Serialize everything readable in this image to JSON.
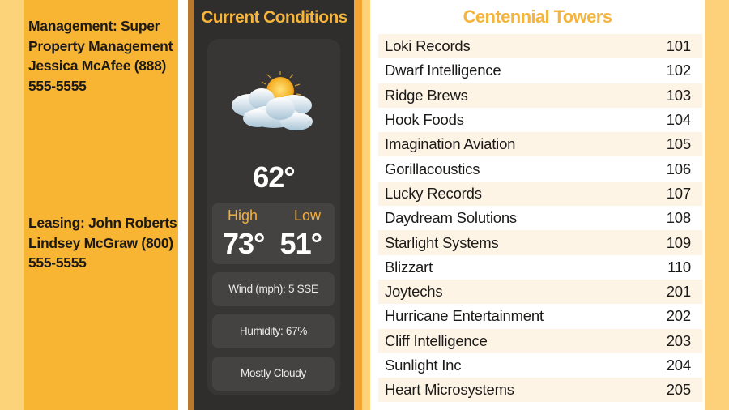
{
  "contacts": {
    "management": "Management: Super Property Management Jessica McAfee (888) 555-5555",
    "leasing": "Leasing: John Roberts Lindsey McGraw (800) 555-5555"
  },
  "weather": {
    "title": "Current Conditions",
    "icon": "partly-cloudy-icon",
    "current_temp": "62°",
    "high_label": "High",
    "low_label": "Low",
    "high": "73°",
    "low": "51°",
    "wind": "Wind (mph): 5 SSE",
    "humidity": "Humidity: 67%",
    "condition": "Mostly Cloudy"
  },
  "directory": {
    "title": "Centennial Towers",
    "tenants": [
      {
        "name": "Loki Records",
        "suite": "101"
      },
      {
        "name": "Dwarf Intelligence",
        "suite": "102"
      },
      {
        "name": "Ridge Brews",
        "suite": "103"
      },
      {
        "name": "Hook Foods",
        "suite": "104"
      },
      {
        "name": "Imagination Aviation",
        "suite": "105"
      },
      {
        "name": "Gorillacoustics",
        "suite": "106"
      },
      {
        "name": "Lucky Records",
        "suite": "107"
      },
      {
        "name": "Daydream Solutions",
        "suite": "108"
      },
      {
        "name": "Starlight Systems",
        "suite": "109"
      },
      {
        "name": "Blizzart",
        "suite": "110"
      },
      {
        "name": "Joytechs",
        "suite": "201"
      },
      {
        "name": "Hurricane Entertainment",
        "suite": "202"
      },
      {
        "name": "Cliff Intelligence",
        "suite": "203"
      },
      {
        "name": "Sunlight Inc",
        "suite": "204"
      },
      {
        "name": "Heart Microsystems",
        "suite": "205"
      }
    ]
  },
  "colors": {
    "accent_orange": "#f8b534",
    "light_yellow": "#fdd37a",
    "dark_panel": "#302e2c",
    "title_gold": "#f5b43c"
  }
}
